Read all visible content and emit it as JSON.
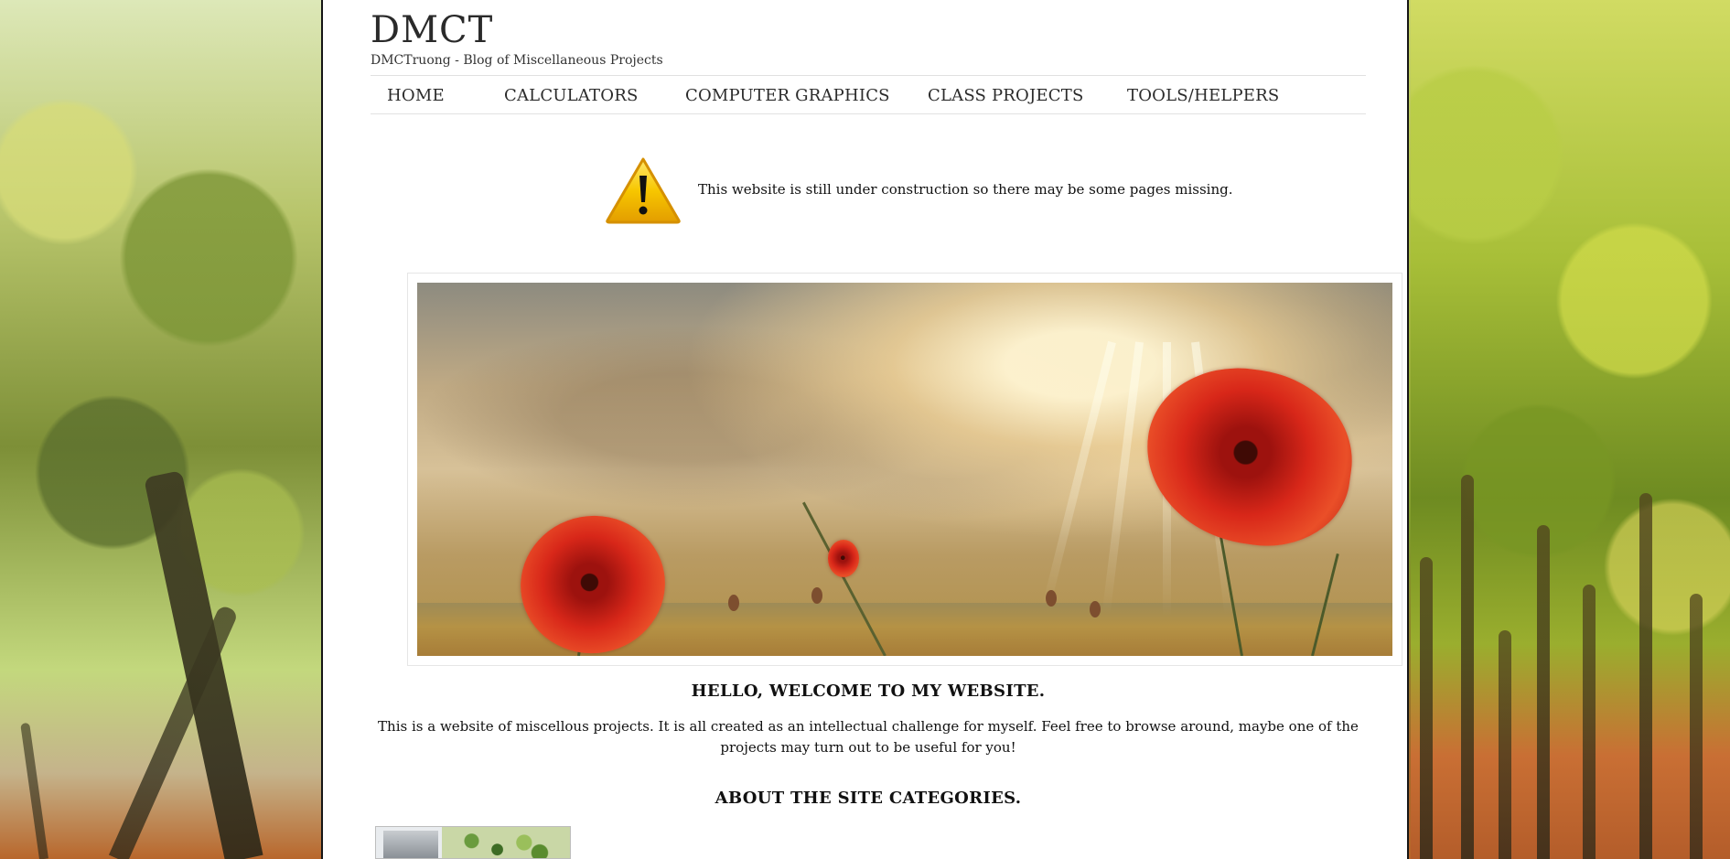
{
  "site": {
    "title": "DMCT",
    "tagline": "DMCTruong - Blog of Miscellaneous Projects"
  },
  "nav": {
    "items": [
      {
        "label": "HOME"
      },
      {
        "label": "CALCULATORS"
      },
      {
        "label": "COMPUTER GRAPHICS"
      },
      {
        "label": "CLASS PROJECTS"
      },
      {
        "label": "TOOLS/HELPERS"
      }
    ]
  },
  "notice": {
    "icon": "warning-icon",
    "text": "This website is still under construction so there may be some pages missing."
  },
  "hero": {
    "image": "poppy-field-banner"
  },
  "content": {
    "welcome_title": "HELLO, WELCOME TO MY WEBSITE.",
    "welcome_text": "This is a website of miscellous projects. It is all created as an intellectual challenge for myself. Feel free to browse around, maybe one of the projects may turn out to be useful for you!",
    "categories_title": "ABOUT THE SITE CATEGORIES."
  },
  "colors": {
    "page_background": "#ffffff",
    "page_border": "#151515",
    "nav_border": "#e1e1e1",
    "text": "#111111",
    "warning_yellow": "#f7c600"
  }
}
